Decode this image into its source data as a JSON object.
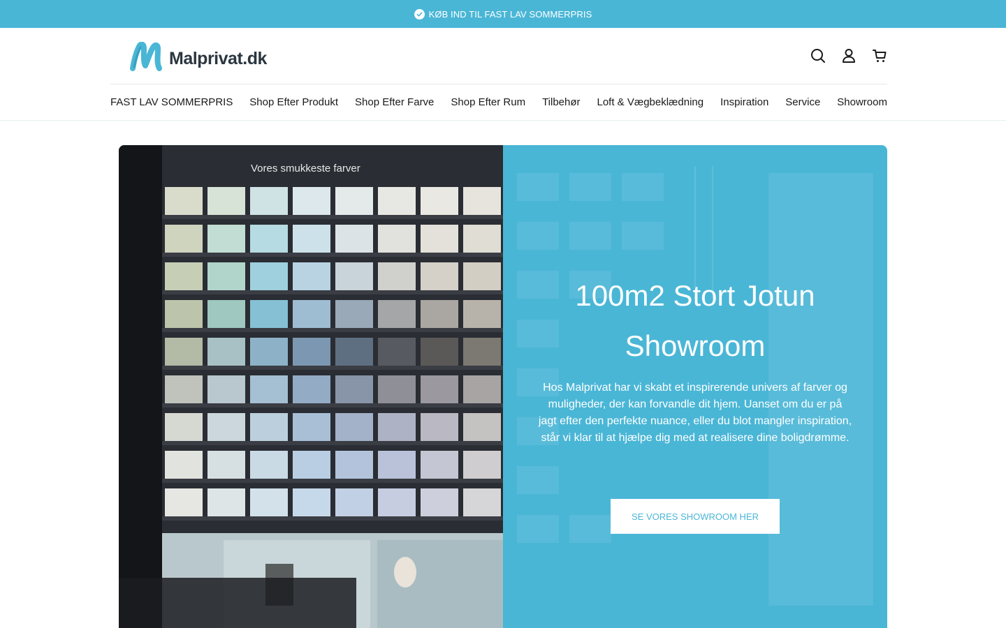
{
  "announcement": {
    "text": "KØB IND TIL FAST LAV SOMMERPRIS",
    "icon": "check-circle-icon"
  },
  "logo": {
    "text_main": "Malprivat",
    "text_suffix": ".dk",
    "icon": "m-brush-logo"
  },
  "header_icons": [
    "search-icon",
    "account-icon",
    "cart-icon"
  ],
  "nav": {
    "items": [
      "FAST LAV SOMMERPRIS",
      "Shop Efter Produkt",
      "Shop Efter Farve",
      "Shop Efter Rum",
      "Tilbehør",
      "Loft & Vægbeklædning",
      "Inspiration",
      "Service",
      "Showroom"
    ]
  },
  "hero": {
    "image_sign": "Vores smukkeste farver",
    "title": "100m2 Stort Jotun Showroom",
    "description": "Hos Malprivat har vi skabt et inspirerende univers af farver og muligheder, der kan forvandle dit hjem. Uanset om du er på jagt efter den perfekte nuance, eller du blot mangler inspiration, står vi klar til at hjælpe dig med at realisere dine boligdrømme.",
    "button_label": "SE VORES SHOWROOM HER"
  },
  "colors": {
    "accent": "#4ab6d6",
    "text": "#1a1a1a",
    "white": "#ffffff"
  }
}
